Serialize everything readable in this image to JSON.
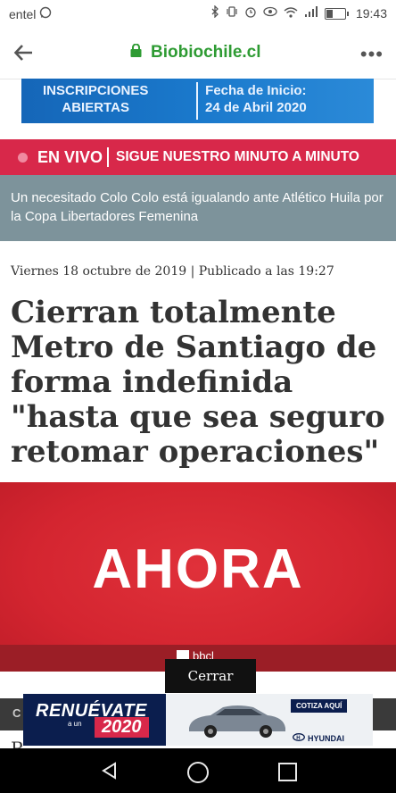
{
  "status_bar": {
    "carrier": "entel",
    "time": "19:43",
    "icons": [
      "whatsapp-icon",
      "bluetooth-icon",
      "vibrate-icon",
      "alarm-icon",
      "eye-icon",
      "wifi-icon",
      "signal-icon",
      "battery-icon"
    ]
  },
  "browser": {
    "domain": "Biobiochile.cl",
    "more": "•••"
  },
  "banner_ad": {
    "left_line1": "INSCRIPCIONES",
    "left_line2": "ABIERTAS",
    "right_line1": "Fecha de Inicio:",
    "right_line2": "24 de Abril 2020"
  },
  "live": {
    "label": "EN VIVO",
    "text": "SIGUE NUESTRO MINUTO A MINUTO",
    "breaking": "Un necesitado Colo Colo está igualando ante Atlético Huila por la Copa Libertadores Femenina"
  },
  "article": {
    "meta": "Viernes 18 octubre de 2019 | Publicado a las 19:27",
    "headline": "Cierran totalmente Metro de Santiago de forma indefinida \"hasta que sea seguro retomar operaciones\"",
    "hero_word": "AHORA",
    "hero_logo": "bbcl",
    "under_letter": "C",
    "next_letter": "R"
  },
  "overlay": {
    "close_label": "Cerrar"
  },
  "bottom_ad": {
    "title": "RENUÉVATE",
    "sub": "a un",
    "year": "2020",
    "cta": "COTIZA AQUÍ",
    "brand": "HYUNDAI"
  },
  "colors": {
    "accent_green": "#2e9b33",
    "live_red": "#d8284a",
    "hero_red": "#d42530",
    "breaking_bg": "#7d939b"
  }
}
